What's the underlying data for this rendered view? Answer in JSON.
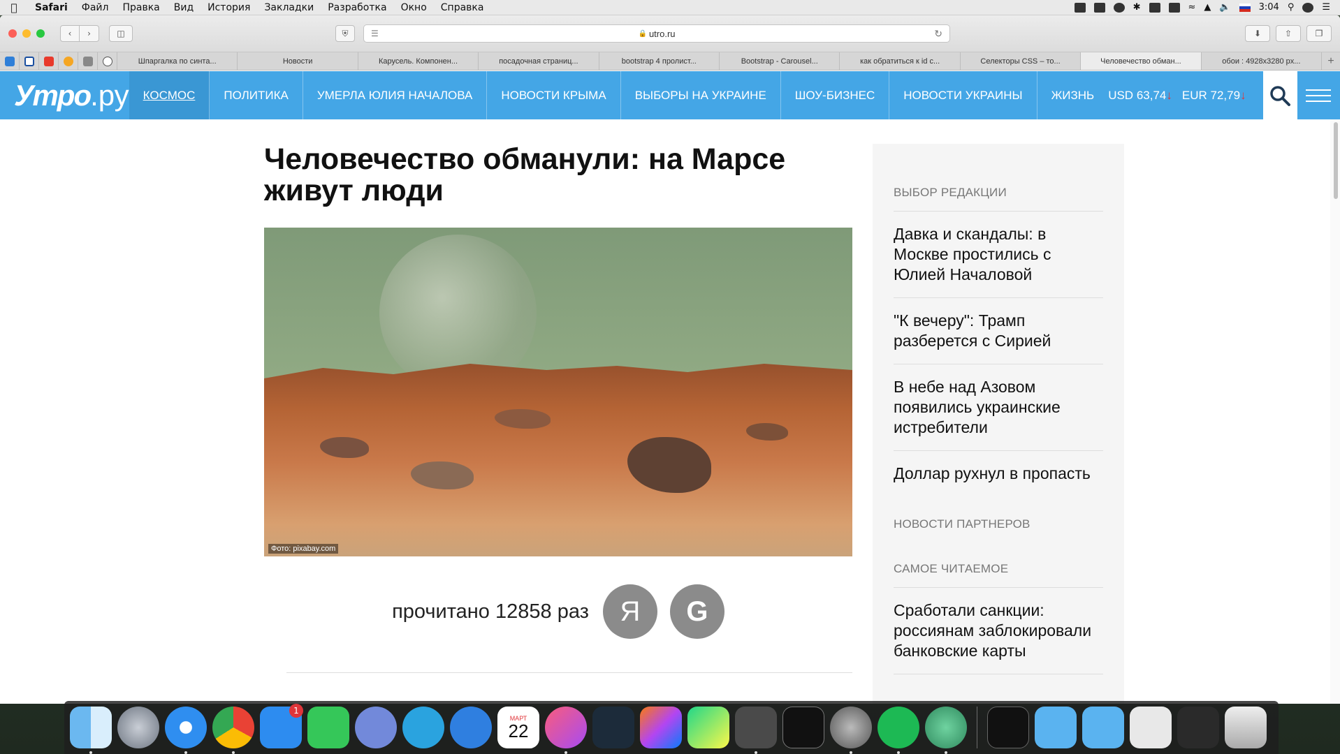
{
  "menubar": {
    "app": "Safari",
    "items": [
      "Файл",
      "Правка",
      "Вид",
      "История",
      "Закладки",
      "Разработка",
      "Окно",
      "Справка"
    ],
    "time": "3:04"
  },
  "browser": {
    "url": "utro.ru",
    "tabs": [
      "Шпаргалка по синта...",
      "Новости",
      "Карусель. Компонен...",
      "посадочная страниц...",
      "bootstrap 4 пролист...",
      "Bootstrap - Carousel...",
      "как обратиться к id c...",
      "Селекторы CSS – то...",
      "Человечество обман...",
      "обои : 4928x3280 px..."
    ],
    "active_tab_index": 8
  },
  "site": {
    "logo_main": "Утро",
    "logo_suffix": ".ру",
    "nav": [
      "Космос",
      "Политика",
      "Умерла Юлия Началова",
      "Новости Крыма",
      "Выборы на Украине",
      "Шоу-бизнес",
      "Новости Украины",
      "Жизнь"
    ],
    "rates": {
      "usd_label": "USD",
      "usd_value": "63,74",
      "eur_label": "EUR",
      "eur_value": "72,79",
      "arrow": "↓"
    }
  },
  "article": {
    "title": "Человечество обманули: на Марсе живут люди",
    "photo_caption": "Фото: pixabay.com",
    "read_count": "прочитано 12858 раз",
    "share_yandex": "Я",
    "share_google": "G"
  },
  "sidebar": {
    "editor_choice_title": "Выбор редакции",
    "editor_items": [
      "Давка и скандалы: в Москве простились с Юлией Началовой",
      "\"К вечеру\": Трамп разберется с Сирией",
      "В небе над Азовом появились украинские истребители",
      "Доллар рухнул в пропасть"
    ],
    "partners_title": "Новости партнеров",
    "most_read_title": "Самое читаемое",
    "most_read_items": [
      "Сработали санкции: россиянам заблокировали банковские карты"
    ]
  },
  "dock": {
    "calendar_month": "МАРТ",
    "calendar_day": "22",
    "appstore_badge": "1"
  },
  "colors": {
    "site_accent": "#44a6e6",
    "rate_down": "#e0353a"
  }
}
